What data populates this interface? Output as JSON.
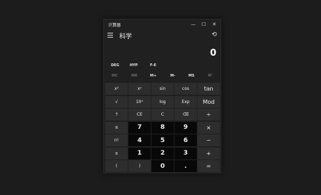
{
  "window": {
    "title": "计算器",
    "minimize": "—",
    "maximize": "☐",
    "close": "✕"
  },
  "header": {
    "mode": "科学",
    "history_icon": "history-icon"
  },
  "display": {
    "value": "0"
  },
  "modes": [
    "DEG",
    "HYP",
    "F-E"
  ],
  "memory": [
    {
      "label": "MC",
      "enabled": false
    },
    {
      "label": "MR",
      "enabled": false
    },
    {
      "label": "M+",
      "enabled": true
    },
    {
      "label": "M-",
      "enabled": true
    },
    {
      "label": "MS",
      "enabled": true
    },
    {
      "label": "M˅",
      "enabled": false
    }
  ],
  "keys": [
    [
      "x²",
      "xʸ",
      "sin",
      "cos",
      "tan"
    ],
    [
      "√",
      "10ˣ",
      "log",
      "Exp",
      "Mod"
    ],
    [
      "↑",
      "CE",
      "C",
      "⌫",
      "÷"
    ],
    [
      "π",
      "7",
      "8",
      "9",
      "×"
    ],
    [
      "n!",
      "4",
      "5",
      "6",
      "−"
    ],
    [
      "±",
      "1",
      "2",
      "3",
      "+"
    ],
    [
      "(",
      ")",
      "0",
      ".",
      "="
    ]
  ],
  "colors": {
    "bg": "#1c1c1c",
    "window": "#202020",
    "fn_key": "#2d2d2d",
    "num_key": "#080808",
    "disabled": "#6a6a6a"
  }
}
